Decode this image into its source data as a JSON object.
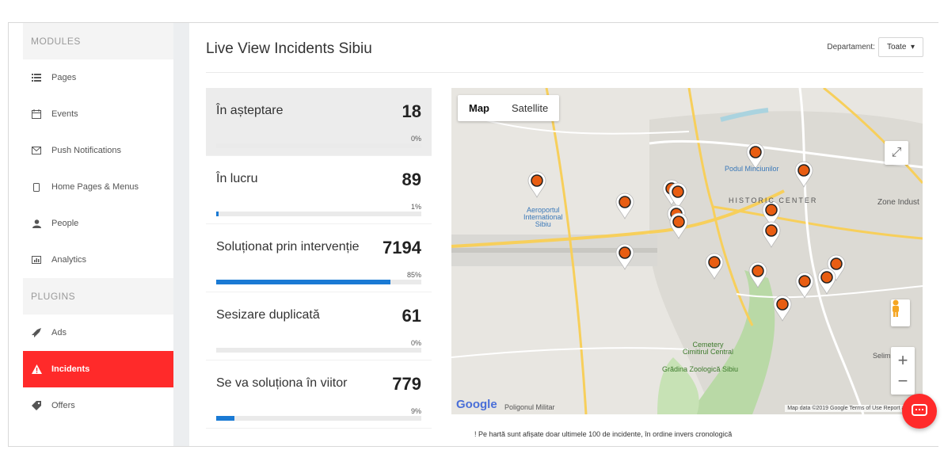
{
  "sidebar": {
    "sections": [
      {
        "label": "MODULES",
        "items": [
          {
            "label": "Pages",
            "icon": "list-icon"
          },
          {
            "label": "Events",
            "icon": "calendar-icon"
          },
          {
            "label": "Push Notifications",
            "icon": "envelope-icon"
          },
          {
            "label": "Home Pages & Menus",
            "icon": "mobile-icon"
          },
          {
            "label": "People",
            "icon": "user-icon"
          },
          {
            "label": "Analytics",
            "icon": "bar-chart-icon"
          }
        ]
      },
      {
        "label": "PLUGINS",
        "items": [
          {
            "label": "Ads",
            "icon": "rocket-icon"
          },
          {
            "label": "Incidents",
            "icon": "warning-icon",
            "active": true
          },
          {
            "label": "Offers",
            "icon": "tag-icon"
          }
        ]
      }
    ]
  },
  "header": {
    "title": "Live View Incidents Sibiu",
    "department_label": "Departament:",
    "department_value": "Toate"
  },
  "stats": [
    {
      "name": "În așteptare",
      "count": "18",
      "percent": 0
    },
    {
      "name": "În lucru",
      "count": "89",
      "percent": 1
    },
    {
      "name": "Soluționat prin intervenție",
      "count": "7194",
      "percent": 85
    },
    {
      "name": "Sesizare duplicată",
      "count": "61",
      "percent": 0
    },
    {
      "name": "Se va soluționa în viitor",
      "count": "779",
      "percent": 9
    }
  ],
  "map": {
    "tab_map": "Map",
    "tab_satellite": "Satellite",
    "labels": {
      "airport": "Aeroportul\nInternational\nSibiu",
      "podul": "Podul Minciunilor",
      "historic": "HISTORIC CENTER",
      "zone": "Zone Indust",
      "cemetery": "Cemetery\nCimitirul Central",
      "zoo": "Grădina Zoologică Sibiu",
      "poligon": "Poligonul Militar",
      "selim": "Selim"
    },
    "google_logo": "Google",
    "footer": "Map data ©2019 Google   Terms of Use   Report a map"
  },
  "note": "! Pe hartă sunt afișate doar ultimele 100 de incidente, în ordine invers cronologică",
  "colors": {
    "accent": "#ff2a2a",
    "bar_fill": "#1a7ad4",
    "marker": "#e85d12"
  }
}
